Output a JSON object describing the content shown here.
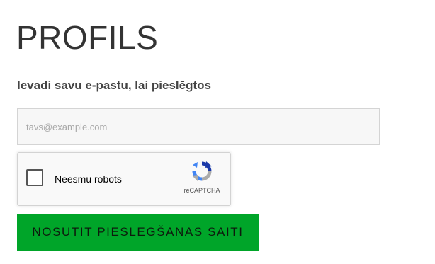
{
  "page": {
    "title": "PROFILS",
    "subtitle": "Ievadi savu e-pastu, lai pieslēgtos"
  },
  "form": {
    "email": {
      "value": "",
      "placeholder": "tavs@example.com"
    },
    "recaptcha": {
      "checkbox_label": "Neesmu robots",
      "brand": "reCAPTCHA",
      "checked": false,
      "icon": "recaptcha-logo-icon"
    },
    "submit_label": "NOSŪTĪT PIESLĒGŠANĀS SAITI"
  },
  "colors": {
    "submit_bg": "#00a529",
    "recaptcha_blue": "#1c3aa9",
    "recaptcha_light_blue": "#4285f4",
    "recaptcha_gray": "#ababab"
  }
}
